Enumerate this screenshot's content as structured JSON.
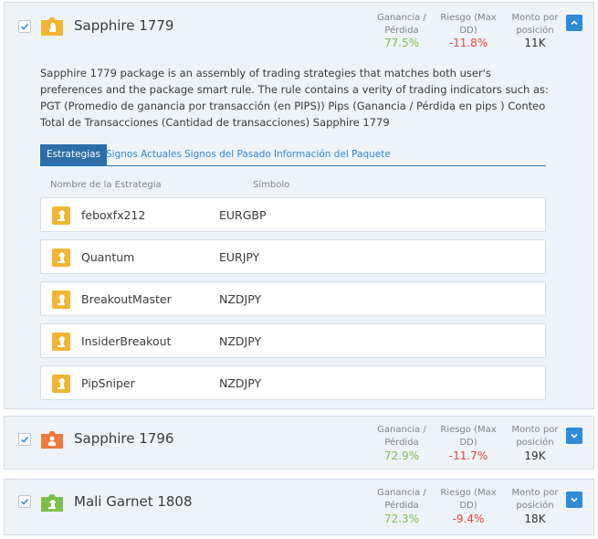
{
  "colors": {
    "accent": "#2f8ad8",
    "active_tab": "#2c6fa8",
    "positive": "#7fbf4d",
    "negative": "#e0463a",
    "card_bg": "#eef3f8",
    "icon_yellow": "#f2b533",
    "icon_orange": "#ef7b3c",
    "icon_green": "#7cc04b"
  },
  "metric_labels": {
    "gain": [
      "Ganancia /",
      "Pérdida"
    ],
    "risk": [
      "Riesgo (Max",
      "DD)"
    ],
    "amount": [
      "Monto por",
      "posición"
    ]
  },
  "packages": [
    {
      "name": "Sapphire 1779",
      "checked": true,
      "icon": "briefcase-yellow-icon",
      "gain": "77.5%",
      "risk": "-11.8%",
      "amount": "11K",
      "expanded": true,
      "toggle_icon": "chevron-up-icon"
    },
    {
      "name": "Sapphire 1796",
      "checked": true,
      "icon": "briefcase-orange-icon",
      "gain": "72.9%",
      "risk": "-11.7%",
      "amount": "19K",
      "expanded": false,
      "toggle_icon": "chevron-down-icon"
    },
    {
      "name": "Mali Garnet 1808",
      "checked": true,
      "icon": "briefcase-green-icon",
      "gain": "72.3%",
      "risk": "-9.4%",
      "amount": "18K",
      "expanded": false,
      "toggle_icon": "chevron-down-icon"
    }
  ],
  "detail": {
    "description": "Sapphire 1779 package is an assembly of trading strategies that matches both user's preferences and the package smart rule. The rule contains a verity of trading indicators such as: PGT (Promedio de ganancia por transacción (en PIPS)) Pips (Ganancia / Pérdida en pips ) Conteo Total de Transacciones (Cantidad de transacciones) Sapphire 1779",
    "tabs": [
      "Estrategias",
      "Signos Actuales",
      "Signos del Pasado",
      "Información del Paquete"
    ],
    "active_tab": 0,
    "columns": [
      "Nombre de la Estrategia",
      "Símbolo"
    ],
    "strategies": [
      {
        "name": "feboxfx212",
        "symbol": "EURGBP",
        "icon": "chess-knight-icon"
      },
      {
        "name": "Quantum",
        "symbol": "EURJPY",
        "icon": "chess-knight-icon"
      },
      {
        "name": "BreakoutMaster",
        "symbol": "NZDJPY",
        "icon": "chess-knight-icon"
      },
      {
        "name": "InsiderBreakout",
        "symbol": "NZDJPY",
        "icon": "chess-knight-icon"
      },
      {
        "name": "PipSniper",
        "symbol": "NZDJPY",
        "icon": "chess-knight-icon"
      }
    ]
  }
}
